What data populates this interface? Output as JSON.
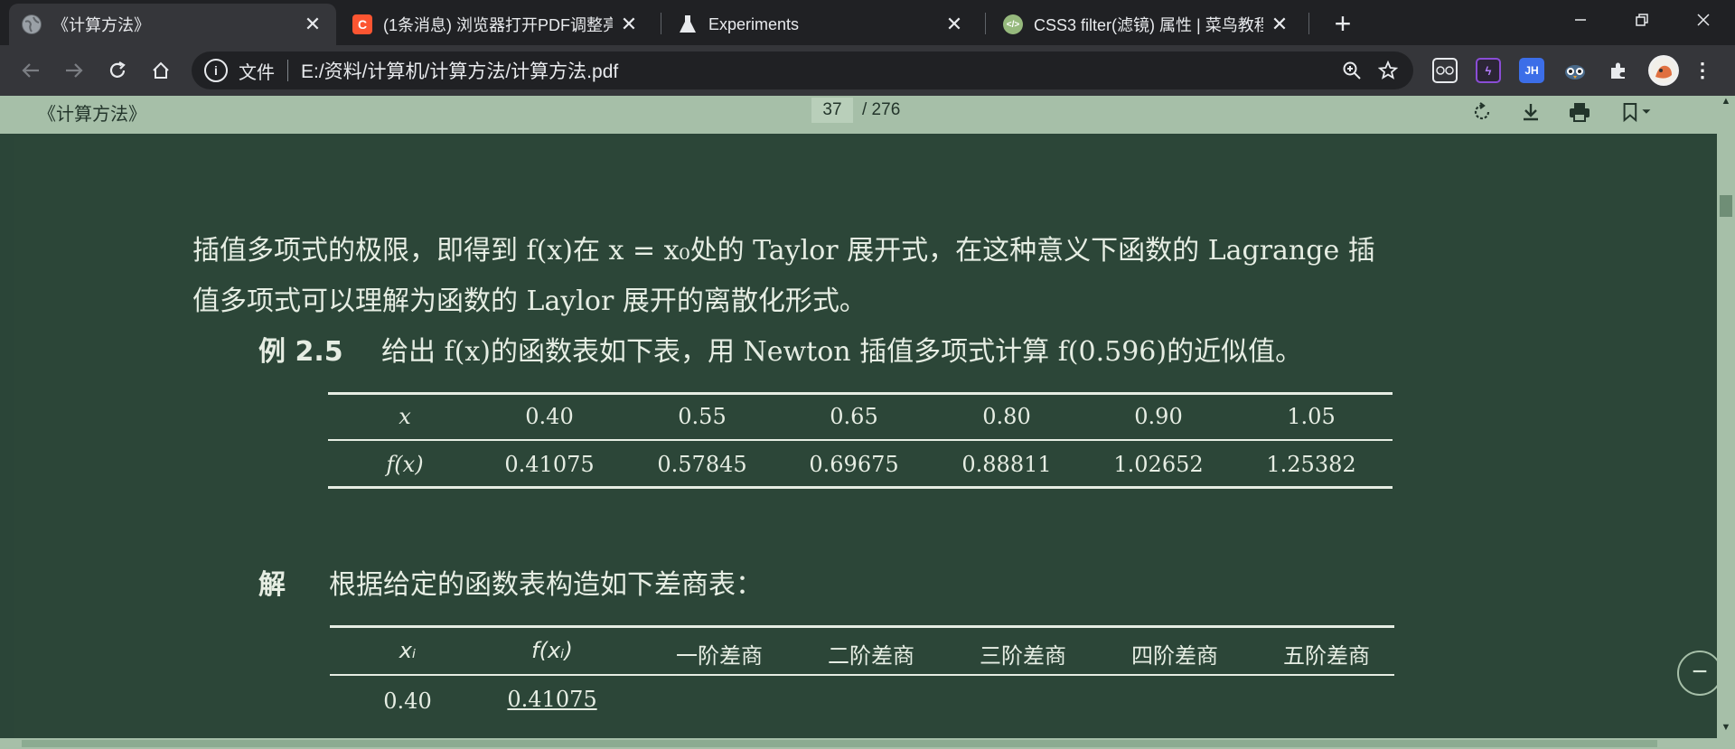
{
  "tabs": [
    {
      "title": "《计算方法》",
      "icon": "globe-icon",
      "active": true
    },
    {
      "title": "(1条消息) 浏览器打开PDF调整亮",
      "icon": "csdn-icon",
      "active": false
    },
    {
      "title": "Experiments",
      "icon": "flask-icon",
      "active": false
    },
    {
      "title": "CSS3 filter(滤镜) 属性 | 菜鸟教程",
      "icon": "runoob-icon",
      "active": false
    }
  ],
  "toolbar": {
    "scheme_label": "文件",
    "url": "E:/资料/计算机/计算方法/计算方法.pdf"
  },
  "extensions": [
    "extension-glasses-icon",
    "extension-bolt-icon",
    "JH",
    "extension-owl-icon",
    "puzzle-icon"
  ],
  "pdf": {
    "title": "《计算方法》",
    "current_page": "37",
    "total_pages": "/ 276"
  },
  "content": {
    "para_line1": "插值多项式的极限，即得到 f(x)在 x = x₀处的 Taylor 展开式，在这种意义下函数的 Lagrange 插",
    "para_line2": "值多项式可以理解为函数的 Laylor 展开的离散化形式。",
    "example_label": "例 2.5",
    "example_text": "给出 f(x)的函数表如下表，用 Newton 插值多项式计算 f(0.596)的近似值。",
    "table1": {
      "row1_header": "x",
      "row2_header": "f(x)",
      "x_values": [
        "0.40",
        "0.55",
        "0.65",
        "0.80",
        "0.90",
        "1.05"
      ],
      "fx_values": [
        "0.41075",
        "0.57845",
        "0.69675",
        "0.88811",
        "1.02652",
        "1.25382"
      ]
    },
    "solution_label": "解",
    "solution_text": "根据给定的函数表构造如下差商表：",
    "table2": {
      "headers": [
        "xᵢ",
        "f(xᵢ)",
        "一阶差商",
        "二阶差商",
        "三阶差商",
        "四阶差商",
        "五阶差商"
      ],
      "first_row": [
        "0.40",
        "0.41075"
      ]
    }
  },
  "colors": {
    "page_background": "#2c4638",
    "pdf_toolbar": "#a6bfa8",
    "text": "#e6ede3"
  }
}
